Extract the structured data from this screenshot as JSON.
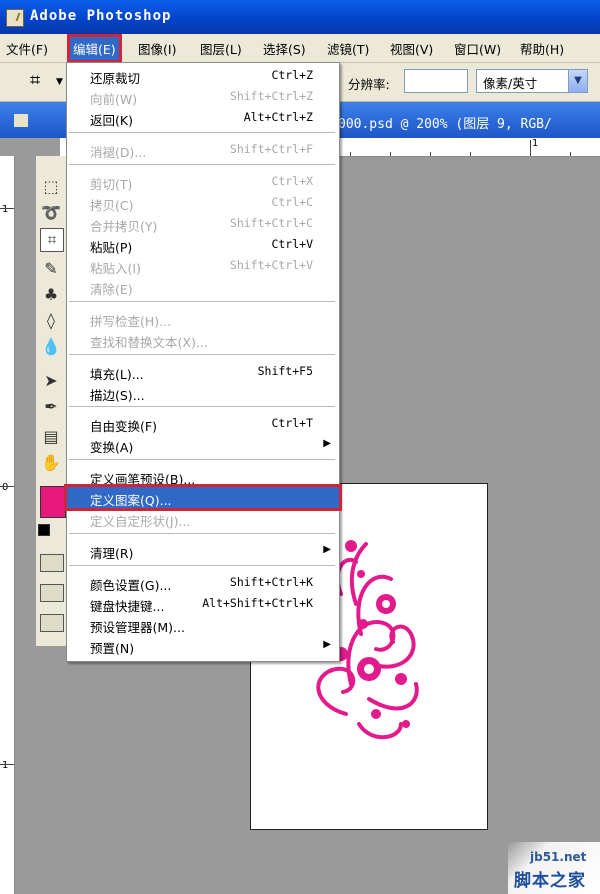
{
  "app": {
    "title": "Adobe Photoshop"
  },
  "menubar": {
    "items": [
      "文件(F)",
      "编辑(E)",
      "图像(I)",
      "图层(L)",
      "选择(S)",
      "滤镜(T)",
      "视图(V)",
      "窗口(W)",
      "帮助(H)"
    ],
    "active_index": 1
  },
  "options": {
    "resolution_label": "分辨率:",
    "resolution_value": "",
    "unit_value": "像素/英寸"
  },
  "document": {
    "title": "000.psd @ 200% (图层 9, RGB/"
  },
  "ruler": {
    "h_label": "1",
    "v_labels": [
      "1",
      "0",
      "1"
    ]
  },
  "edit_menu": {
    "items": [
      {
        "label": "还原裁切",
        "shortcut": "Ctrl+Z",
        "disabled": false
      },
      {
        "label": "向前(W)",
        "shortcut": "Shift+Ctrl+Z",
        "disabled": true
      },
      {
        "label": "返回(K)",
        "shortcut": "Alt+Ctrl+Z",
        "disabled": false
      },
      {
        "label": "消褪(D)...",
        "shortcut": "Shift+Ctrl+F",
        "disabled": true
      },
      {
        "label": "剪切(T)",
        "shortcut": "Ctrl+X",
        "disabled": true
      },
      {
        "label": "拷贝(C)",
        "shortcut": "Ctrl+C",
        "disabled": true
      },
      {
        "label": "合并拷贝(Y)",
        "shortcut": "Shift+Ctrl+C",
        "disabled": true
      },
      {
        "label": "粘贴(P)",
        "shortcut": "Ctrl+V",
        "disabled": false
      },
      {
        "label": "粘贴入(I)",
        "shortcut": "Shift+Ctrl+V",
        "disabled": true
      },
      {
        "label": "清除(E)",
        "shortcut": "",
        "disabled": true
      },
      {
        "label": "拼写检查(H)...",
        "shortcut": "",
        "disabled": true
      },
      {
        "label": "查找和替换文本(X)...",
        "shortcut": "",
        "disabled": true
      },
      {
        "label": "填充(L)...",
        "shortcut": "Shift+F5",
        "disabled": false
      },
      {
        "label": "描边(S)...",
        "shortcut": "",
        "disabled": false
      },
      {
        "label": "自由变换(F)",
        "shortcut": "Ctrl+T",
        "disabled": false
      },
      {
        "label": "变换(A)",
        "shortcut": "",
        "disabled": false,
        "submenu": true
      },
      {
        "label": "定义画笔预设(B)...",
        "shortcut": "",
        "disabled": false
      },
      {
        "label": "定义图案(Q)...",
        "shortcut": "",
        "disabled": false,
        "highlighted": true
      },
      {
        "label": "定义自定形状(J)...",
        "shortcut": "",
        "disabled": true
      },
      {
        "label": "清理(R)",
        "shortcut": "",
        "disabled": false,
        "submenu": true
      },
      {
        "label": "颜色设置(G)...",
        "shortcut": "Shift+Ctrl+K",
        "disabled": false
      },
      {
        "label": "键盘快捷键...",
        "shortcut": "Alt+Shift+Ctrl+K",
        "disabled": false
      },
      {
        "label": "预设管理器(M)...",
        "shortcut": "",
        "disabled": false
      },
      {
        "label": "预置(N)",
        "shortcut": "",
        "disabled": false,
        "submenu": true
      }
    ]
  },
  "colors": {
    "foreground": "#e8197d",
    "highlight_border": "#d0243a",
    "menu_highlight": "#3169c6"
  },
  "watermark": {
    "line1": "jb51.net",
    "line2": "脚本之家"
  }
}
